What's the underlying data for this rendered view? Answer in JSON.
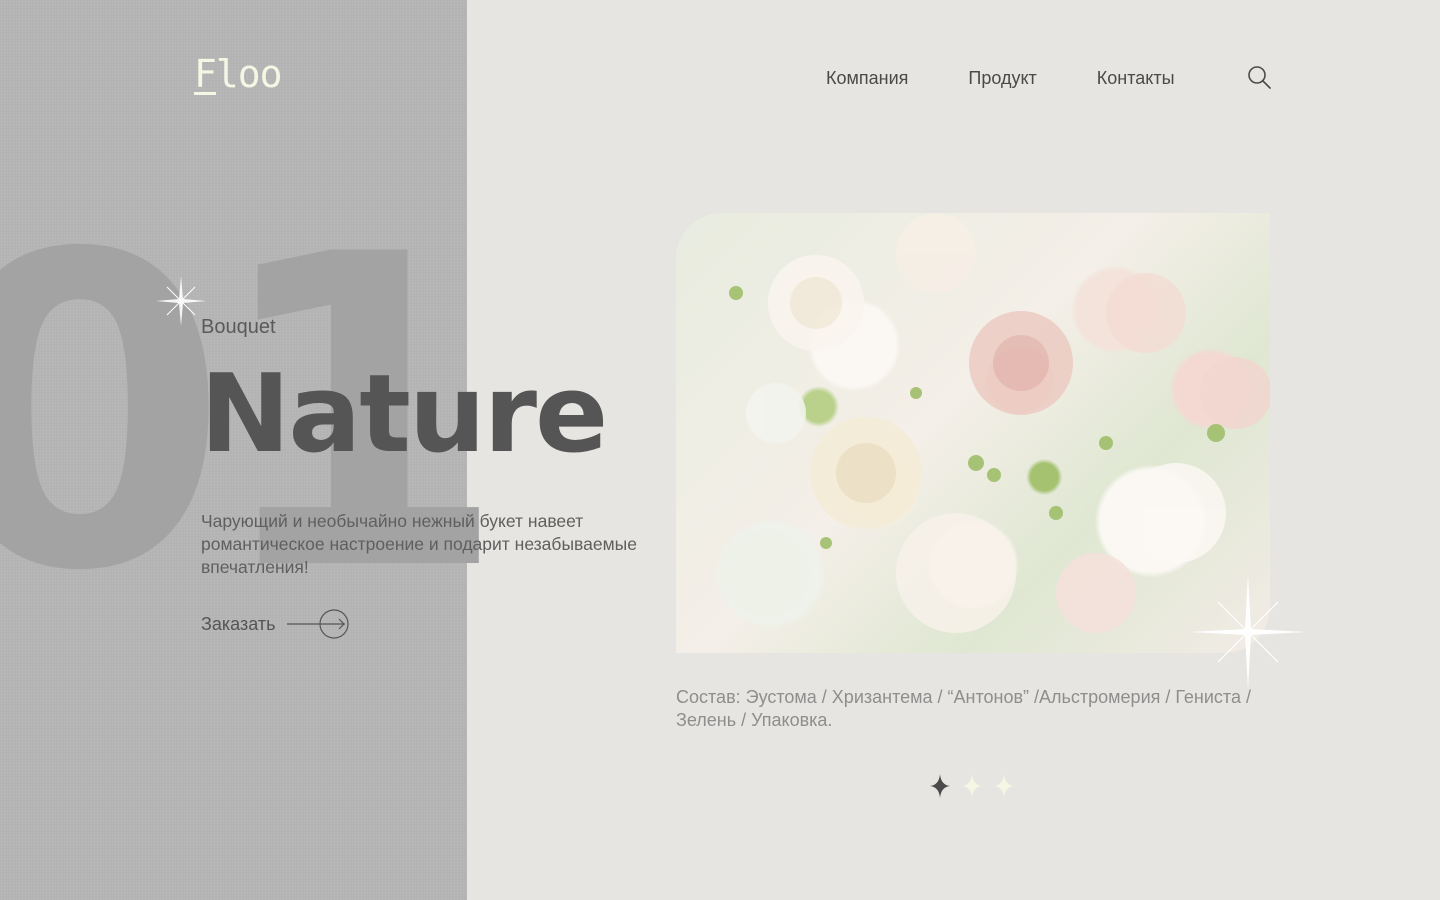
{
  "brand": {
    "logo_text": "Floo",
    "color": "#f5f6e4"
  },
  "nav": {
    "items": [
      {
        "label": "Компания"
      },
      {
        "label": "Продукт"
      },
      {
        "label": "Контакты"
      }
    ],
    "search_icon": "search-icon"
  },
  "hero": {
    "bg_number": "01",
    "eyebrow": "Bouquet",
    "title": "Nature",
    "description": "Чарующий и необычайно нежный букет навеет романтическое настроение и подарит незабываемые впечатления!",
    "cta_label": "Заказать",
    "cta_icon": "arrow-right-circle-icon"
  },
  "product": {
    "composition": "Состав: Эустома / Хризантема / “Антонов” /Альстромерия / Гениста / Зелень / Упаковка."
  },
  "slider": {
    "count": 3,
    "active_index": 0,
    "active_color": "#4a4a4a",
    "inactive_color": "#f5f6e4"
  },
  "colors": {
    "left_panel": "#b3b3b3",
    "background": "#e6e5e1",
    "text_dark": "#555555"
  }
}
